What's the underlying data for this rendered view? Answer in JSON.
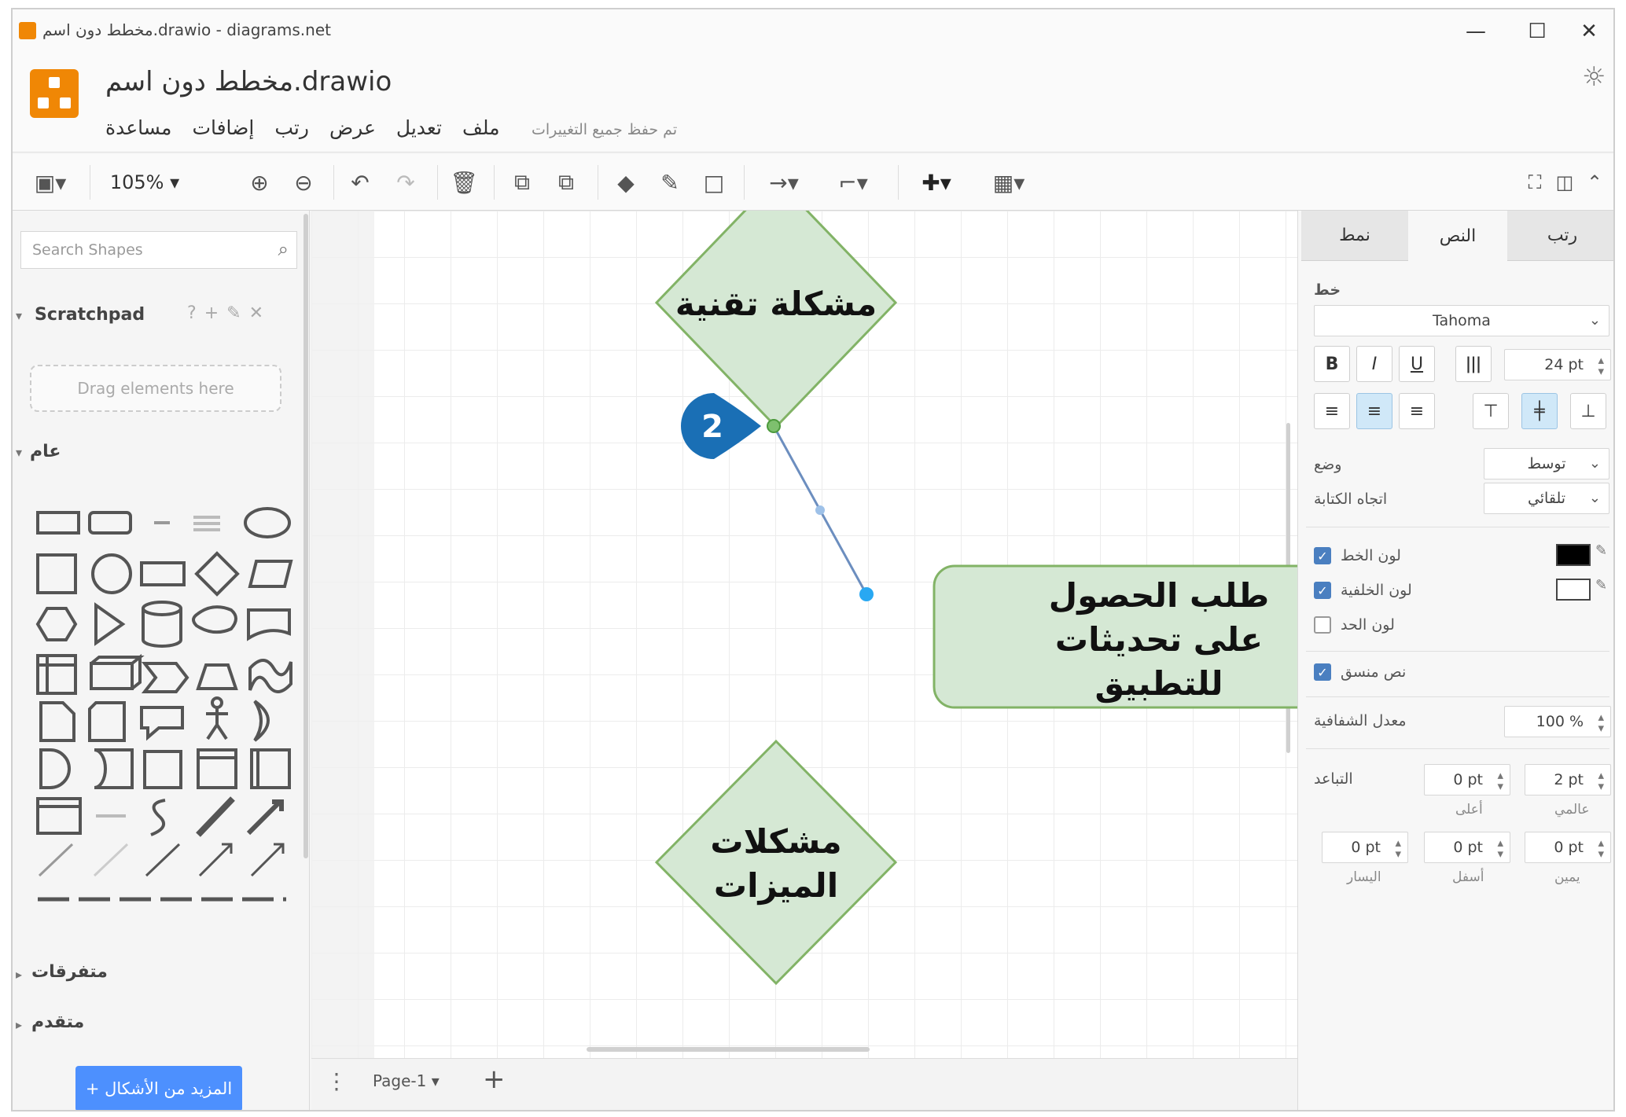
{
  "window": {
    "title": "مخطط دون اسم.drawio - diagrams.net",
    "controls": {
      "minimize": "—",
      "maximize": "☐",
      "close": "✕"
    }
  },
  "header": {
    "filename": "مخطط دون اسم.drawio",
    "menus": [
      "ملف",
      "تعديل",
      "عرض",
      "رتب",
      "إضافات",
      "مساعدة"
    ],
    "saved_status": "تم حفظ جميع التغييرات"
  },
  "toolbar": {
    "zoom": "105%"
  },
  "sidebar": {
    "search_placeholder": "Search Shapes",
    "scratchpad_title": "Scratchpad",
    "scratchpad_drop": "Drag elements here",
    "general_title": "عام",
    "misc_title": "متفرقات",
    "advanced_title": "متقدم",
    "more_shapes": "+ المزيد من الأشكال"
  },
  "diagram": {
    "shape1_text": "مشكلة تقنية",
    "shape2_lines": [
      "طلب الحصول",
      "على تحديثات",
      "للتطبيق"
    ],
    "shape3_lines": [
      "مشكلات",
      "الميزات"
    ],
    "callout_number": "2",
    "colors": {
      "fill": "#d5e8d4",
      "stroke": "#82b366",
      "connector": "#6c8ebf",
      "callout": "#1a6fb5"
    }
  },
  "pages": {
    "current": "Page-1"
  },
  "format_panel": {
    "tabs": [
      "نمط",
      "النص",
      "رتب"
    ],
    "active_tab": "النص",
    "font_section": "خط",
    "font_family": "Tahoma",
    "font_size": "24 pt",
    "position_label": "وضع",
    "position_value": "توسط",
    "direction_label": "اتجاه الكتابة",
    "direction_value": "تلقائي",
    "font_color_label": "لون الخط",
    "background_color_label": "لون الخلفية",
    "border_color_label": "لون الحد",
    "formatted_text_label": "نص منسق",
    "opacity_label": "معدل الشفافية",
    "opacity_value": "100 %",
    "spacing_label": "التباعد",
    "spacing": {
      "top": {
        "value": "0 pt",
        "label": "أعلى"
      },
      "global": {
        "value": "2 pt",
        "label": "عالمي"
      },
      "left": {
        "value": "0 pt",
        "label": "اليسار"
      },
      "bottom": {
        "value": "0 pt",
        "label": "أسفل"
      },
      "right": {
        "value": "0 pt",
        "label": "يمين"
      }
    }
  }
}
